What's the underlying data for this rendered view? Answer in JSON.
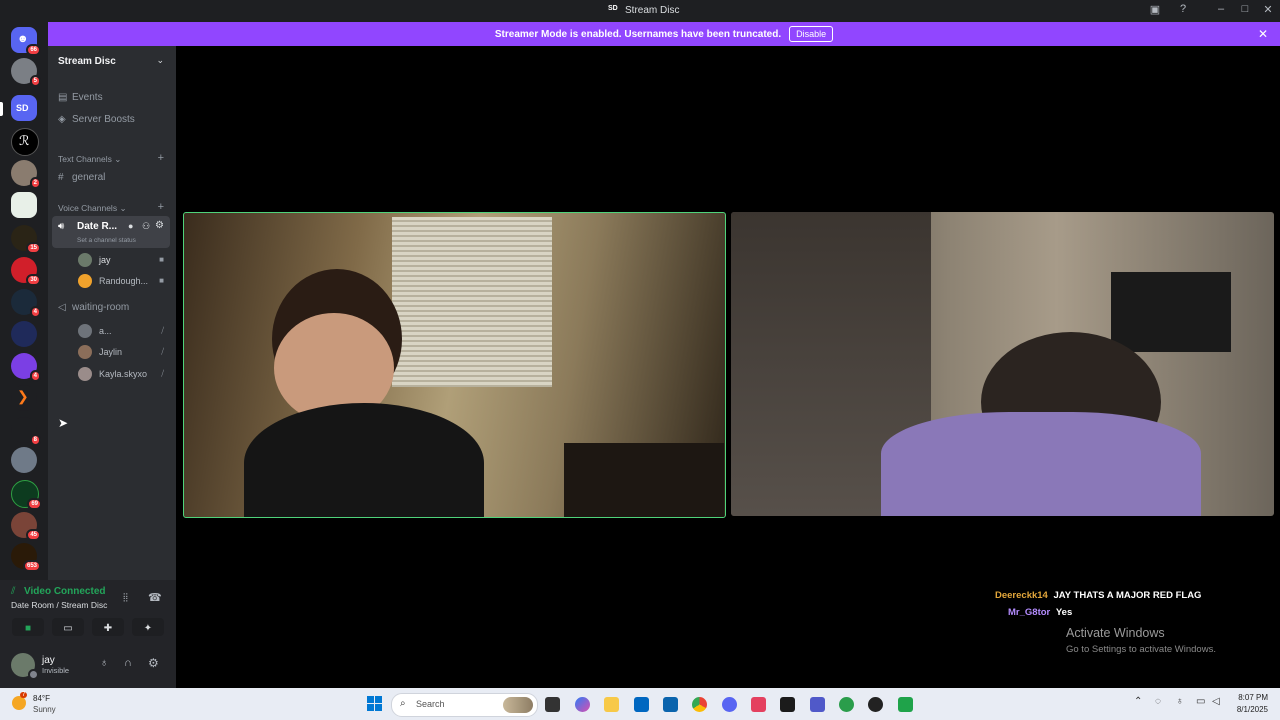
{
  "window": {
    "title": "Stream Disc",
    "title_abbr": "SD"
  },
  "banner": {
    "message": "Streamer Mode is enabled. Usernames have been truncated.",
    "button": "Disable"
  },
  "rail": {
    "servers": [
      {
        "badge": "66",
        "color": "#5865f2"
      },
      {
        "badge": "5",
        "color": "#7b7f85"
      },
      {
        "badge": "",
        "label": "SD",
        "color": "#5865f2"
      },
      {
        "badge": "",
        "color": "#000000"
      },
      {
        "badge": "2",
        "color": "#8a7c6f"
      },
      {
        "badge": "",
        "color": "#e8f0e8"
      },
      {
        "badge": "15",
        "color": "#2a2416"
      },
      {
        "badge": "30",
        "color": "#d11f2a"
      },
      {
        "badge": "4",
        "color": "#1b2a3a"
      },
      {
        "badge": "",
        "color": "#1f2a5a"
      },
      {
        "badge": "4",
        "color": "#7b3fe4"
      },
      {
        "badge": "",
        "color": "#1e1f22"
      },
      {
        "badge": "8",
        "color": "#1e1f22"
      },
      {
        "badge": "",
        "color": "#6f7a88"
      },
      {
        "badge": "69",
        "color": "#0d3b1f"
      },
      {
        "badge": "45",
        "color": "#7a4438"
      },
      {
        "badge": "653",
        "color": "#2a1a08"
      }
    ]
  },
  "sidebar": {
    "server_name": "Stream Disc",
    "events": "Events",
    "server_boosts": "Server Boosts",
    "text_category": "Text Channels",
    "general": "general",
    "voice_category": "Voice Channels",
    "active_channel": "Date R...",
    "channel_status": "Set a channel status",
    "active_users": [
      "jay",
      "Randough..."
    ],
    "waiting_room": "waiting-room",
    "waiting_users": [
      "a...",
      "Jaylin",
      "Kayla.skyxo"
    ]
  },
  "voice_panel": {
    "status": "Video Connected",
    "location": "Date Room / Stream Disc"
  },
  "user_panel": {
    "name": "jay",
    "status": "Invisible"
  },
  "chat_overlay": [
    {
      "user": "Deereckk14",
      "message": "JAY THATS A MAJOR RED FLAG",
      "color": "#e2a63b"
    },
    {
      "user": "Mr_G8tor",
      "message": "Yes",
      "color": "#b48cff"
    }
  ],
  "activation": {
    "title": "Activate Windows",
    "subtitle": "Go to Settings to activate Windows."
  },
  "taskbar": {
    "weather_temp": "84°F",
    "weather_desc": "Sunny",
    "weather_badge": "7",
    "search_placeholder": "Search",
    "time": "8:07 PM",
    "date": "8/1/2025"
  },
  "colors": {
    "accent": "#9146ff",
    "speaking": "#4fd37a",
    "connected": "#23a55a"
  }
}
